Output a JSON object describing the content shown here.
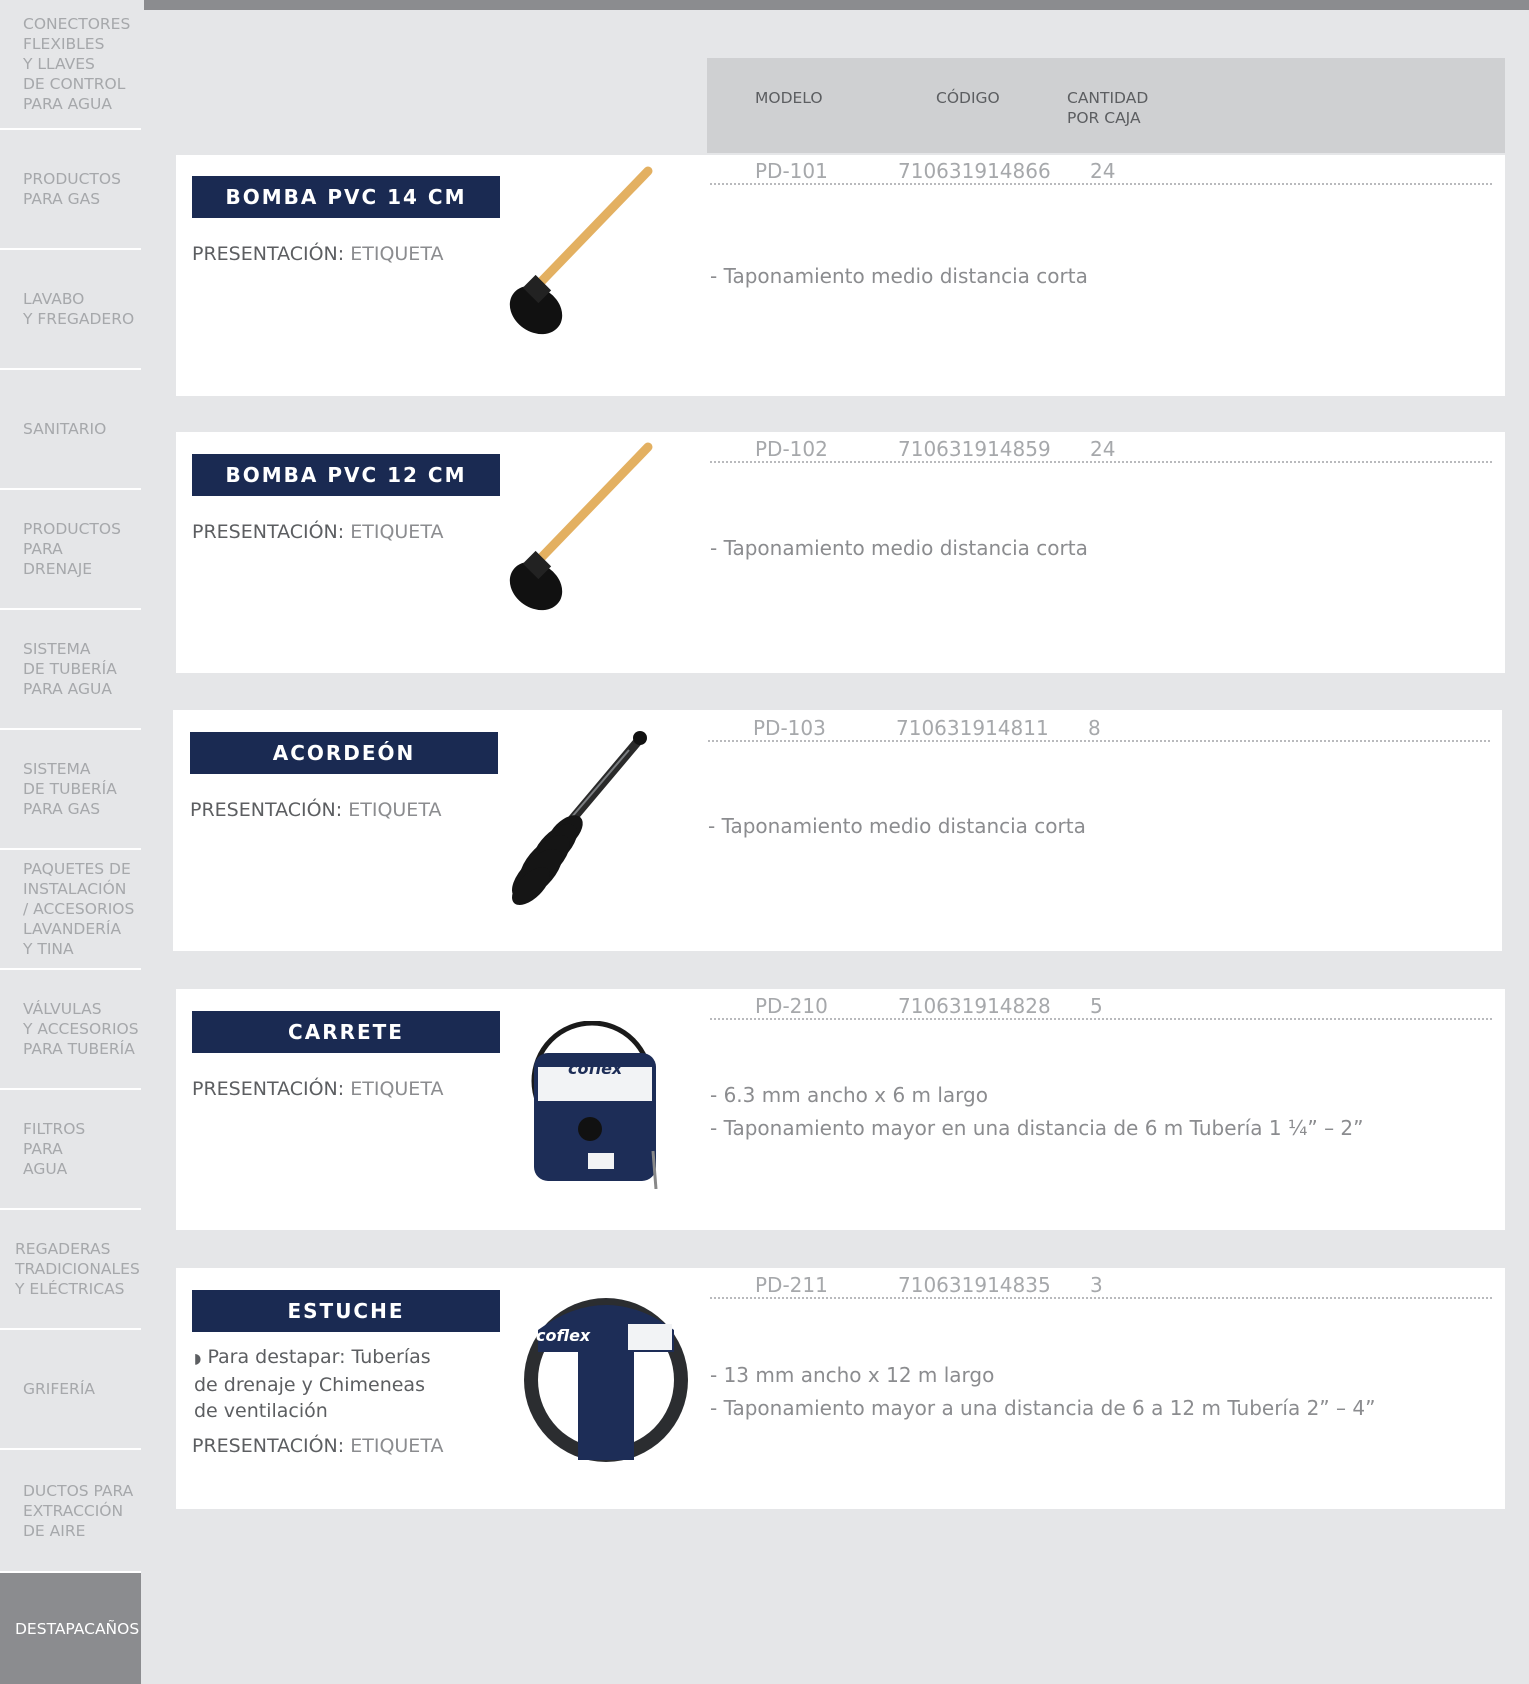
{
  "sidebar": {
    "items": [
      {
        "label": "CONECTORES\nFLEXIBLES\nY LLAVES\nDE CONTROL\nPARA AGUA"
      },
      {
        "label": "PRODUCTOS\nPARA GAS"
      },
      {
        "label": "LAVABO\nY FREGADERO"
      },
      {
        "label": "SANITARIO"
      },
      {
        "label": "PRODUCTOS\nPARA\nDRENAJE"
      },
      {
        "label": "SISTEMA\nDE TUBERÍA\nPARA AGUA"
      },
      {
        "label": "SISTEMA\nDE TUBERÍA\nPARA GAS"
      },
      {
        "label": "PAQUETES DE\nINSTALACIÓN\n/ ACCESORIOS\nLAVANDERÍA\nY TINA"
      },
      {
        "label": "VÁLVULAS\nY ACCESORIOS\nPARA TUBERÍA"
      },
      {
        "label": "FILTROS\nPARA\nAGUA"
      },
      {
        "label": "REGADERAS\nTRADICIONALES\nY ELÉCTRICAS"
      },
      {
        "label": "GRIFERÍA"
      },
      {
        "label": "DUCTOS PARA\nEXTRACCIÓN\nDE AIRE"
      },
      {
        "label": "DESTAPACAÑOS"
      }
    ]
  },
  "table_header": {
    "modelo": "MODELO",
    "codigo": "CÓDIGO",
    "cantidad": "CANTIDAD\nPOR CAJA"
  },
  "presentacion_label": "PRESENTACIÓN:",
  "products": [
    {
      "name": "BOMBA PVC 14 CM",
      "presentacion": "ETIQUETA",
      "modelo": "PD-101",
      "codigo": "710631914866",
      "cantidad": "24",
      "desc1": "- Taponamiento medio distancia corta",
      "image": "plunger-icon"
    },
    {
      "name": "BOMBA PVC 12 CM",
      "presentacion": "ETIQUETA",
      "modelo": "PD-102",
      "codigo": "710631914859",
      "cantidad": "24",
      "desc1": "- Taponamiento medio distancia corta",
      "image": "plunger-icon"
    },
    {
      "name": "ACORDEÓN",
      "presentacion": "ETIQUETA",
      "modelo": "PD-103",
      "codigo": "710631914811",
      "cantidad": "8",
      "desc1": "- Taponamiento medio distancia corta",
      "image": "accordion-plunger-icon"
    },
    {
      "name": "CARRETE",
      "presentacion": "ETIQUETA",
      "modelo": "PD-210",
      "codigo": "710631914828",
      "cantidad": "5",
      "desc1": "- 6.3 mm ancho x 6 m largo",
      "desc2": "- Taponamiento mayor en una distancia de 6 m Tubería 1 ¼” – 2”",
      "image": "reel-package-icon",
      "brand": "coflex"
    },
    {
      "name": "ESTUCHE",
      "presentacion": "ETIQUETA",
      "note": "Para destapar: Tuberías de drenaje y Chimeneas de ventilación",
      "modelo": "PD-211",
      "codigo": "710631914835",
      "cantidad": "3",
      "desc1": "- 13 mm ancho x 12 m largo",
      "desc2": "- Taponamiento mayor a una distancia de 6 a 12 m Tubería 2” – 4”",
      "image": "case-reel-icon",
      "brand": "coflex"
    }
  ],
  "colors": {
    "background": "#e5e6e8",
    "navy": "#1a2a52",
    "sidebar_active": "#8b8c8f",
    "header_bg": "#cfd0d2"
  }
}
